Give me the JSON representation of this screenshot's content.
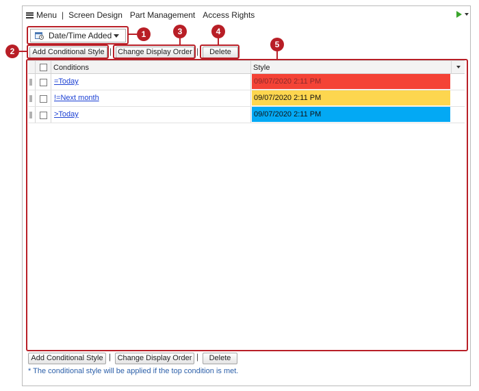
{
  "menubar": {
    "menu_label": "Menu",
    "separator": "|",
    "items": [
      "Screen Design",
      "Part Management",
      "Access Rights"
    ]
  },
  "field_select": {
    "value": "Date/Time Added"
  },
  "toolbar": {
    "add_label": "Add Conditional Style",
    "order_label": "Change Display Order",
    "delete_label": "Delete",
    "separator": "|"
  },
  "grid": {
    "columns": [
      "Conditions",
      "Style"
    ],
    "rows": [
      {
        "condition": "=Today",
        "style_text": "09/07/2020 2:11 PM",
        "style_bg": "#f44336",
        "style_fg": "#8a2a2a"
      },
      {
        "condition": "!=Next month",
        "style_text": "09/07/2020 2:11 PM",
        "style_bg": "#fdd64f",
        "style_fg": "#111111"
      },
      {
        "condition": ">Today",
        "style_text": "09/07/2020 2:11 PM",
        "style_bg": "#03a9f4",
        "style_fg": "#111111"
      }
    ]
  },
  "callouts": [
    "1",
    "2",
    "3",
    "4",
    "5"
  ],
  "footer_note": "* The conditional style will be applied if the top condition is met.",
  "colors": {
    "callout": "#b81e26",
    "link": "#1a3fd3",
    "note": "#2a5ea8",
    "run": "#3aa52c"
  }
}
